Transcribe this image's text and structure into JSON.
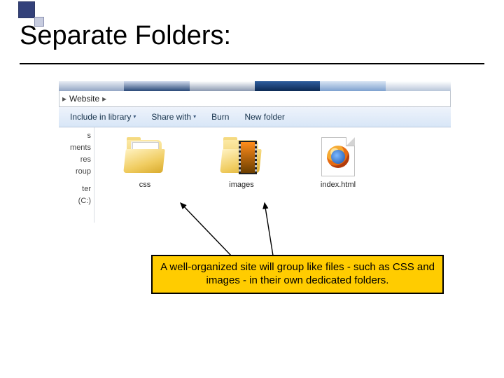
{
  "title": "Separate Folders:",
  "breadcrumb": {
    "item": "Website"
  },
  "toolbar": {
    "include": "Include in library",
    "share": "Share with",
    "burn": "Burn",
    "newfolder": "New folder"
  },
  "sidebar": {
    "i0": "s",
    "i1": "ments",
    "i2": "",
    "i3": "res",
    "i4": "",
    "i5": "roup",
    "i6": "ter",
    "i7": "(C:)"
  },
  "files": {
    "f0": {
      "label": "css"
    },
    "f1": {
      "label": "images"
    },
    "f2": {
      "label": "index.html"
    }
  },
  "callout": "A well-organized site will group like files - such as CSS and images - in their own dedicated folders."
}
